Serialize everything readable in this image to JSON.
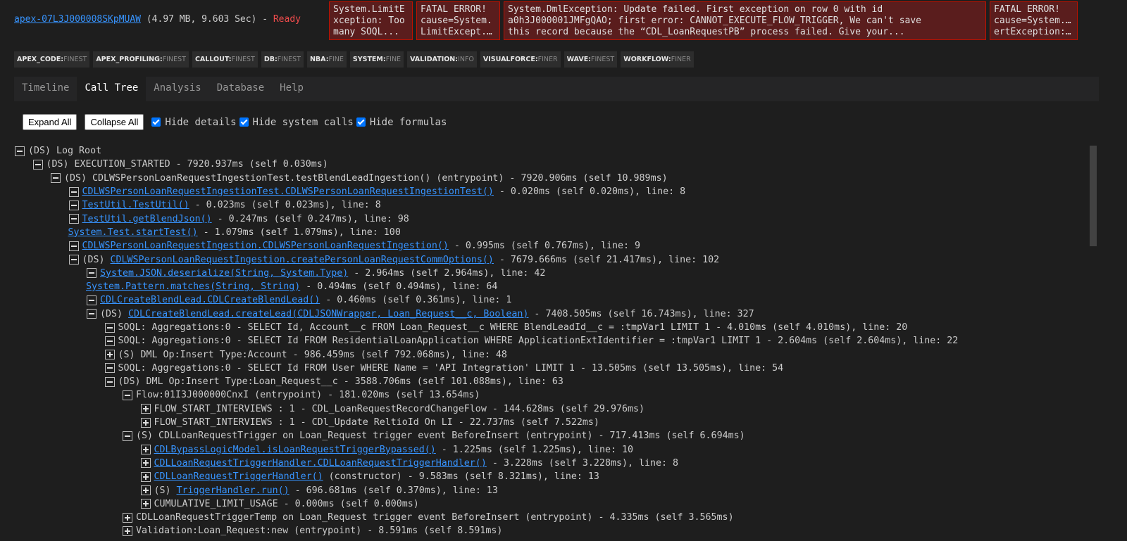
{
  "header": {
    "log_name": "apex-07L3J000008SKpMUAW",
    "log_meta": " (4.97 MB, 9.603 Sec) - ",
    "status": "Ready"
  },
  "errors": [
    {
      "line1": "System.LimitE",
      "line2": "xception: Too",
      "line3": "many SOQL..."
    },
    {
      "line1": "FATAL ERROR!",
      "line2": "cause=System.",
      "line3": "LimitExcept..."
    },
    {
      "line1": "System.DmlException: Update failed. First exception on row 0 with id",
      "line2": "a0h3J000001JMFgQAO; first error: CANNOT_EXECUTE_FLOW_TRIGGER, We can't save",
      "line3": "this record because the “CDL_LoanRequestPB” process failed. Give your..."
    },
    {
      "line1": "FATAL ERROR!",
      "line2": "cause=System.Ass",
      "line3": "ertException:..."
    }
  ],
  "log_levels": [
    {
      "key": "APEX_CODE:",
      "val": "FINEST"
    },
    {
      "key": "APEX_PROFILING:",
      "val": "FINEST"
    },
    {
      "key": "CALLOUT:",
      "val": "FINEST"
    },
    {
      "key": "DB:",
      "val": "FINEST"
    },
    {
      "key": "NBA:",
      "val": "FINE"
    },
    {
      "key": "SYSTEM:",
      "val": "FINE"
    },
    {
      "key": "VALIDATION:",
      "val": "INFO"
    },
    {
      "key": "VISUALFORCE:",
      "val": "FINER"
    },
    {
      "key": "WAVE:",
      "val": "FINEST"
    },
    {
      "key": "WORKFLOW:",
      "val": "FINER"
    }
  ],
  "tabs": [
    {
      "label": "Timeline",
      "active": false
    },
    {
      "label": "Call Tree",
      "active": true
    },
    {
      "label": "Analysis",
      "active": false
    },
    {
      "label": "Database",
      "active": false
    },
    {
      "label": "Help",
      "active": false
    }
  ],
  "toolbar": {
    "expand_all": "Expand All",
    "collapse_all": "Collapse All",
    "hide_details": "Hide details",
    "hide_system_calls": "Hide system calls",
    "hide_formulas": "Hide formulas"
  },
  "tree": [
    {
      "indent": 0,
      "toggle": "minus",
      "pre": "(DS) ",
      "link": "",
      "text": "Log Root"
    },
    {
      "indent": 1,
      "toggle": "minus",
      "pre": "(DS) ",
      "link": "",
      "text": "EXECUTION_STARTED - 7920.937ms (self 0.030ms)"
    },
    {
      "indent": 2,
      "toggle": "minus",
      "pre": "(DS) ",
      "link": "",
      "text": "CDLWSPersonLoanRequestIngestionTest.testBlendLeadIngestion() (entrypoint) - 7920.906ms (self 10.989ms)"
    },
    {
      "indent": 3,
      "toggle": "minus",
      "pre": "",
      "link": "CDLWSPersonLoanRequestIngestionTest.CDLWSPersonLoanRequestIngestionTest()",
      "text": " - 0.020ms (self 0.020ms), line: 8"
    },
    {
      "indent": 3,
      "toggle": "minus",
      "pre": "",
      "link": "TestUtil.TestUtil()",
      "text": " - 0.023ms (self 0.023ms), line: 8"
    },
    {
      "indent": 3,
      "toggle": "minus",
      "pre": "",
      "link": "TestUtil.getBlendJson()",
      "text": " - 0.247ms (self 0.247ms), line: 98"
    },
    {
      "indent": 3,
      "toggle": "none",
      "pre": "",
      "link": "System.Test.startTest()",
      "text": " - 1.079ms (self 1.079ms), line: 100"
    },
    {
      "indent": 3,
      "toggle": "minus",
      "pre": "",
      "link": "CDLWSPersonLoanRequestIngestion.CDLWSPersonLoanRequestIngestion()",
      "text": " - 0.995ms (self 0.767ms), line: 9"
    },
    {
      "indent": 3,
      "toggle": "minus",
      "pre": "(DS) ",
      "link": "CDLWSPersonLoanRequestIngestion.createPersonLoanRequestCommOptions()",
      "text": " - 7679.666ms (self 21.417ms), line: 102"
    },
    {
      "indent": 4,
      "toggle": "minus",
      "pre": "",
      "link": "System.JSON.deserialize(String, System.Type)",
      "text": " - 2.964ms (self 2.964ms), line: 42"
    },
    {
      "indent": 4,
      "toggle": "none",
      "pre": "",
      "link": "System.Pattern.matches(String, String)",
      "text": " - 0.494ms (self 0.494ms), line: 64"
    },
    {
      "indent": 4,
      "toggle": "minus",
      "pre": "",
      "link": "CDLCreateBlendLead.CDLCreateBlendLead()",
      "text": " - 0.460ms (self 0.361ms), line: 1"
    },
    {
      "indent": 4,
      "toggle": "minus",
      "pre": "(DS) ",
      "link": "CDLCreateBlendLead.createLead(CDLJSONWrapper, Loan_Request__c, Boolean)",
      "text": " - 7408.505ms (self 16.743ms), line: 327"
    },
    {
      "indent": 5,
      "toggle": "minus",
      "pre": "",
      "link": "",
      "text": "SOQL: Aggregations:0 - SELECT Id, Account__c FROM Loan_Request__c WHERE BlendLeadId__c = :tmpVar1 LIMIT 1 - 4.010ms (self 4.010ms), line: 20"
    },
    {
      "indent": 5,
      "toggle": "minus",
      "pre": "",
      "link": "",
      "text": "SOQL: Aggregations:0 - SELECT Id FROM ResidentialLoanApplication WHERE ApplicationExtIdentifier = :tmpVar1 LIMIT 1 - 2.604ms (self 2.604ms), line: 22"
    },
    {
      "indent": 5,
      "toggle": "plus",
      "pre": "(S) ",
      "link": "",
      "text": "DML Op:Insert Type:Account - 986.459ms (self 792.068ms), line: 48"
    },
    {
      "indent": 5,
      "toggle": "minus",
      "pre": "",
      "link": "",
      "text": "SOQL: Aggregations:0 - SELECT Id FROM User WHERE Name = 'API Integration' LIMIT 1 - 13.505ms (self 13.505ms), line: 54"
    },
    {
      "indent": 5,
      "toggle": "minus",
      "pre": "(DS) ",
      "link": "",
      "text": "DML Op:Insert Type:Loan_Request__c - 3588.706ms (self 101.088ms), line: 63"
    },
    {
      "indent": 6,
      "toggle": "minus",
      "pre": "",
      "link": "",
      "text": "Flow:01I3J000000CnxI (entrypoint) - 181.020ms (self 13.654ms)"
    },
    {
      "indent": 7,
      "toggle": "plus",
      "pre": "",
      "link": "",
      "text": "FLOW_START_INTERVIEWS : 1 - CDL_LoanRequestRecordChangeFlow - 144.628ms (self 29.976ms)"
    },
    {
      "indent": 7,
      "toggle": "plus",
      "pre": "",
      "link": "",
      "text": "FLOW_START_INTERVIEWS : 1 - CDl_Update ReltioId On LI - 22.737ms (self 7.522ms)"
    },
    {
      "indent": 6,
      "toggle": "minus",
      "pre": "(S) ",
      "link": "",
      "text": "CDLLoanRequestTrigger on Loan_Request trigger event BeforeInsert (entrypoint) - 717.413ms (self 6.694ms)"
    },
    {
      "indent": 7,
      "toggle": "plus",
      "pre": "",
      "link": "CDLBypassLogicModel.isLoanRequestTriggerBypassed()",
      "text": " - 1.225ms (self 1.225ms), line: 10"
    },
    {
      "indent": 7,
      "toggle": "plus",
      "pre": "",
      "link": "CDLLoanRequestTriggerHandler.CDLLoanRequestTriggerHandler()",
      "text": " - 3.228ms (self 3.228ms), line: 8"
    },
    {
      "indent": 7,
      "toggle": "plus",
      "pre": "",
      "link": "CDLLoanRequestTriggerHandler()",
      "text": " (constructor) - 9.583ms (self 8.321ms), line: 13"
    },
    {
      "indent": 7,
      "toggle": "plus",
      "pre": "(S) ",
      "link": "TriggerHandler.run()",
      "text": " - 696.681ms (self 0.370ms), line: 13"
    },
    {
      "indent": 7,
      "toggle": "plus",
      "pre": "",
      "link": "",
      "text": "CUMULATIVE_LIMIT_USAGE - 0.000ms (self 0.000ms)"
    },
    {
      "indent": 6,
      "toggle": "plus",
      "pre": "",
      "link": "",
      "text": "CDLLoanRequestTriggerTemp on Loan_Request trigger event BeforeInsert (entrypoint) - 4.335ms (self 3.565ms)"
    },
    {
      "indent": 6,
      "toggle": "plus",
      "pre": "",
      "link": "",
      "text": "Validation:Loan_Request:new (entrypoint) - 8.591ms (self 8.591ms)"
    }
  ]
}
